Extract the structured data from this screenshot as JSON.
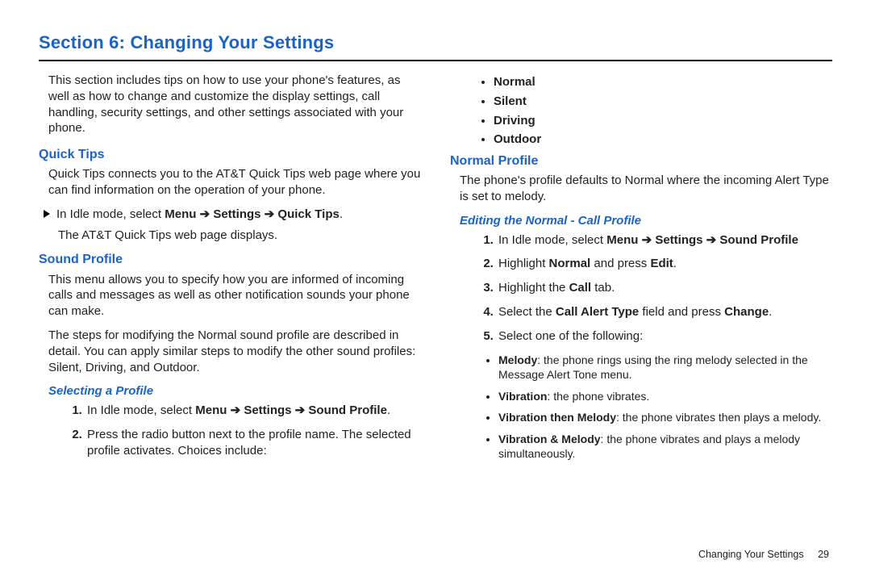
{
  "title": "Section 6: Changing Your Settings",
  "intro": "This section includes tips on how to use your phone's features, as well as how to change and customize the display settings, call handling, security settings, and other settings associated with your phone.",
  "quick_tips": {
    "heading": "Quick Tips",
    "body": "Quick Tips connects you to the AT&T Quick Tips web page where you can find information on the operation of your phone.",
    "step_pre": "In Idle mode, select ",
    "step_b1": "Menu",
    "arrow": " ➔ ",
    "step_b2": "Settings",
    "step_b3": "Quick Tips",
    "period": ".",
    "after": "The AT&T Quick Tips web page displays."
  },
  "sound_profile": {
    "heading": "Sound Profile",
    "p1": "This menu allows you to specify how you are informed of incoming calls and messages as well as other notification sounds your phone can make.",
    "p2": "The steps for modifying the Normal sound profile are described in detail. You can apply similar steps to modify the other sound profiles: Silent, Driving, and Outdoor.",
    "selecting": {
      "heading": "Selecting a Profile",
      "s1_pre": "In Idle mode, select ",
      "s1_b1": "Menu",
      "arrow": " ➔ ",
      "s1_b2": "Settings",
      "s1_b3": "Sound Profile",
      "period": ".",
      "s2": "Press the radio button next to the profile name. The selected profile activates. Choices include:"
    }
  },
  "profiles": {
    "a": "Normal",
    "b": "Silent",
    "c": "Driving",
    "d": "Outdoor"
  },
  "normal_profile": {
    "heading": "Normal Profile",
    "body": "The phone's profile defaults to Normal where the incoming Alert Type is set to melody.",
    "editing": {
      "heading": "Editing the Normal - Call Profile",
      "s1_pre": "In Idle mode, select ",
      "s1_b1": "Menu",
      "arrow": " ➔ ",
      "s1_b2": "Settings",
      "s1_b3": "Sound Profile",
      "s2_pre": "Highlight ",
      "s2_b1": "Normal",
      "s2_mid": " and press ",
      "s2_b2": "Edit",
      "period": ".",
      "s3_pre": "Highlight the ",
      "s3_b1": "Call",
      "s3_post": " tab.",
      "s4_pre": "Select the ",
      "s4_b1": "Call Alert Type",
      "s4_mid": " field and press ",
      "s4_b2": "Change",
      "s5": "Select one of the following:",
      "opts": {
        "a_b": "Melody",
        "a_t": ": the phone rings using the ring melody selected in the Message Alert Tone menu.",
        "b_b": "Vibration",
        "b_t": ": the phone vibrates.",
        "c_b": "Vibration then Melody",
        "c_t": ": the phone vibrates then plays a melody.",
        "d_b": "Vibration & Melody",
        "d_t": ": the phone vibrates and plays a melody simultaneously."
      }
    }
  },
  "footer": {
    "label": "Changing Your Settings",
    "page": "29"
  }
}
